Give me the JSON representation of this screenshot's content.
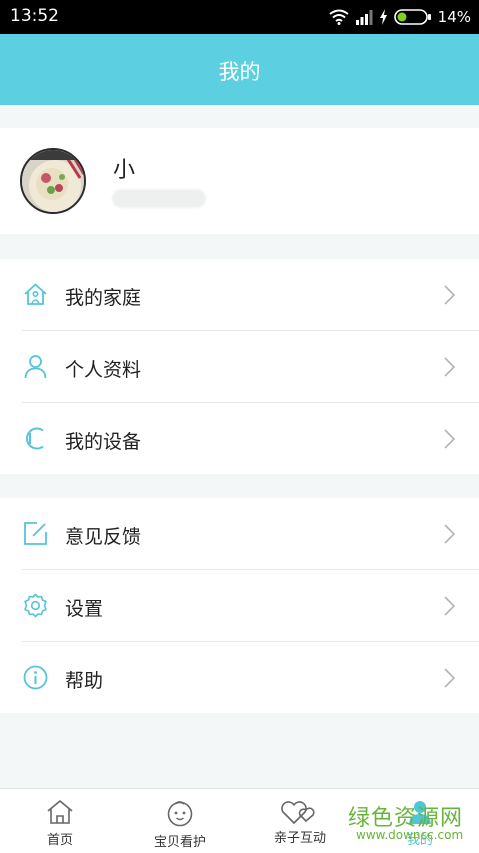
{
  "status_bar": {
    "time": "13:52",
    "battery": "14%",
    "icons": [
      "wifi-icon",
      "signal-icon",
      "charging-icon",
      "battery-icon"
    ]
  },
  "header": {
    "title": "我的"
  },
  "profile": {
    "name": "小"
  },
  "menu_group_1": [
    {
      "label": "我的家庭",
      "icon": "home-icon"
    },
    {
      "label": "个人资料",
      "icon": "person-icon"
    },
    {
      "label": "我的设备",
      "icon": "device-icon"
    }
  ],
  "menu_group_2": [
    {
      "label": "意见反馈",
      "icon": "edit-icon"
    },
    {
      "label": "设置",
      "icon": "gear-icon"
    },
    {
      "label": "帮助",
      "icon": "info-icon"
    }
  ],
  "tabbar": [
    {
      "label": "首页",
      "icon": "home-tab-icon"
    },
    {
      "label": "宝贝看护",
      "icon": "baby-icon"
    },
    {
      "label": "亲子互动",
      "icon": "hearts-icon"
    },
    {
      "label": "我的",
      "icon": "user-tab-icon"
    }
  ],
  "watermark": {
    "text": "绿色资源网",
    "url": "www.downcc.com"
  },
  "colors": {
    "accent": "#5ccfe1",
    "icon": "#56c4d8",
    "background": "#f4f7f7",
    "watermark": "#67b43a"
  }
}
